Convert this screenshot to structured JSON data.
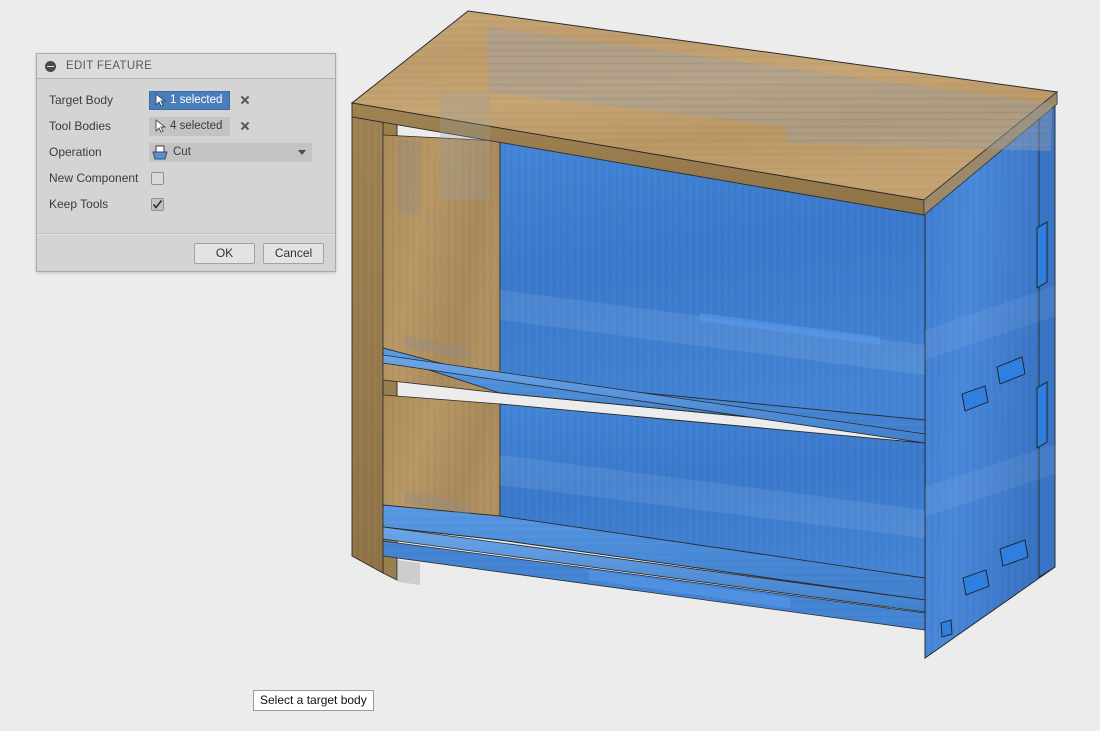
{
  "app": {
    "background_color": "#ececec"
  },
  "dialog": {
    "title": "EDIT FEATURE",
    "collapse_icon": "collapse-circle-minus-icon",
    "rows": [
      {
        "label": "Target Body",
        "control": "selection",
        "value": "1 selected",
        "active": true,
        "icon": "cursor-arrow-icon",
        "clear_icon": "close-x-icon"
      },
      {
        "label": "Tool Bodies",
        "control": "selection",
        "value": "4 selected",
        "active": false,
        "icon": "cursor-arrow-icon",
        "clear_icon": "close-x-icon"
      },
      {
        "label": "Operation",
        "control": "dropdown",
        "value": "Cut",
        "icon": "cut-operation-icon",
        "caret_icon": "chevron-down-icon"
      },
      {
        "label": "New Component",
        "control": "checkbox",
        "checked": false
      },
      {
        "label": "Keep Tools",
        "control": "checkbox",
        "checked": true
      }
    ],
    "buttons": {
      "ok": "OK",
      "cancel": "Cancel"
    },
    "colors": {
      "active_selection": "#4a7ebb",
      "panel": "#d4d4d4",
      "titlebar": "#dcdcdc"
    }
  },
  "status": {
    "message": "Select a target body"
  },
  "model": {
    "name": "bookshelf-assembly",
    "description": "3D bookshelf with wooden top and left side, blue highlighted tool bodies",
    "wood_color": "#b59363",
    "highlight_color": "#3c7ad1"
  }
}
